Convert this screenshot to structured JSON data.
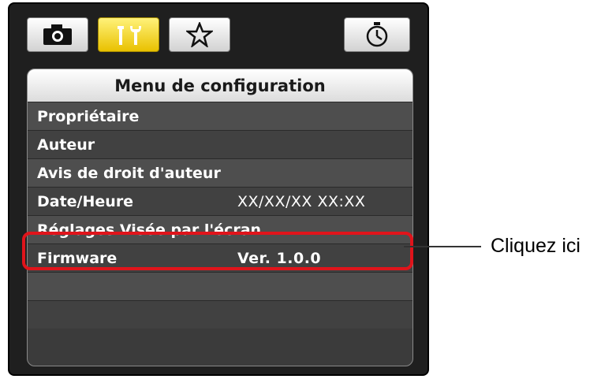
{
  "tabs": [
    {
      "name": "camera-tab",
      "icon": "camera-icon",
      "active": false
    },
    {
      "name": "setup-tab",
      "icon": "wrench-icon",
      "active": true
    },
    {
      "name": "mymenu-tab",
      "icon": "star-icon",
      "active": false
    },
    {
      "name": "timer-tab",
      "icon": "timer-icon",
      "active": false
    }
  ],
  "menu": {
    "title": "Menu de configuration",
    "items": [
      {
        "label": "Propriétaire",
        "value": ""
      },
      {
        "label": "Auteur",
        "value": ""
      },
      {
        "label": "Avis de droit d'auteur",
        "value": ""
      },
      {
        "label": "Date/Heure",
        "value": "XX/XX/XX XX:XX"
      },
      {
        "label": "Réglages Visée par l'écran",
        "value": ""
      },
      {
        "label": "Firmware",
        "value": "Ver. 1.0.0"
      },
      {
        "label": "",
        "value": ""
      },
      {
        "label": "",
        "value": ""
      }
    ]
  },
  "callout": {
    "text": "Cliquez ici"
  },
  "colors": {
    "highlight": "#e0141b",
    "active_tab": "#f5d800",
    "panel": "#1f1f1f"
  }
}
